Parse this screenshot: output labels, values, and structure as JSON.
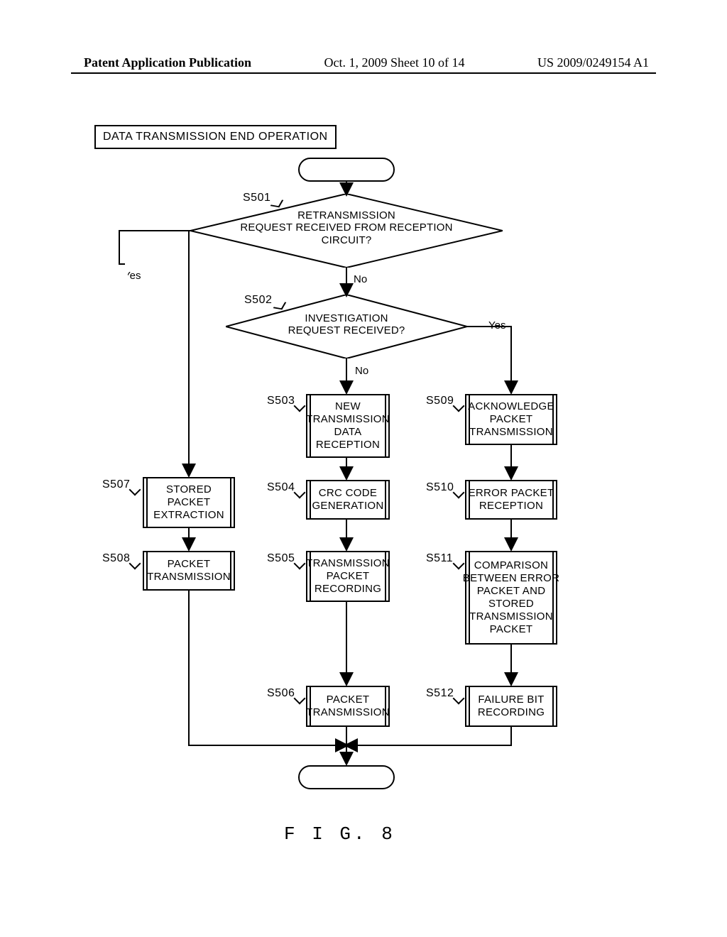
{
  "header": {
    "left": "Patent Application Publication",
    "mid": "Oct. 1, 2009   Sheet 10 of 14",
    "right": "US 2009/0249154 A1"
  },
  "title": "DATA TRANSMISSION END OPERATION",
  "decisions": {
    "d1": {
      "label": "S501",
      "text": "RETRANSMISSION\nREQUEST RECEIVED FROM RECEPTION\nCIRCUIT?"
    },
    "d2": {
      "label": "S502",
      "text": "INVESTIGATION\nREQUEST RECEIVED?"
    }
  },
  "edges": {
    "yes": "Yes",
    "no": "No"
  },
  "steps": {
    "s503": {
      "label": "S503",
      "text": "NEW\nTRANSMISSION\nDATA\nRECEPTION"
    },
    "s504": {
      "label": "S504",
      "text": "CRC CODE\nGENERATION"
    },
    "s505": {
      "label": "S505",
      "text": "TRANSMISSION\nPACKET\nRECORDING"
    },
    "s506": {
      "label": "S506",
      "text": "PACKET\nTRANSMISSION"
    },
    "s507": {
      "label": "S507",
      "text": "STORED\nPACKET\nEXTRACTION"
    },
    "s508": {
      "label": "S508",
      "text": "PACKET\nTRANSMISSION"
    },
    "s509": {
      "label": "S509",
      "text": "ACKNOWLEDGE\nPACKET\nTRANSMISSION"
    },
    "s510": {
      "label": "S510",
      "text": "ERROR PACKET\nRECEPTION"
    },
    "s511": {
      "label": "S511",
      "text": "COMPARISON\nBETWEEN ERROR\nPACKET AND\nSTORED\nTRANSMISSION\nPACKET"
    },
    "s512": {
      "label": "S512",
      "text": "FAILURE BIT\nRECORDING"
    }
  },
  "figure_caption": "F I G.   8"
}
